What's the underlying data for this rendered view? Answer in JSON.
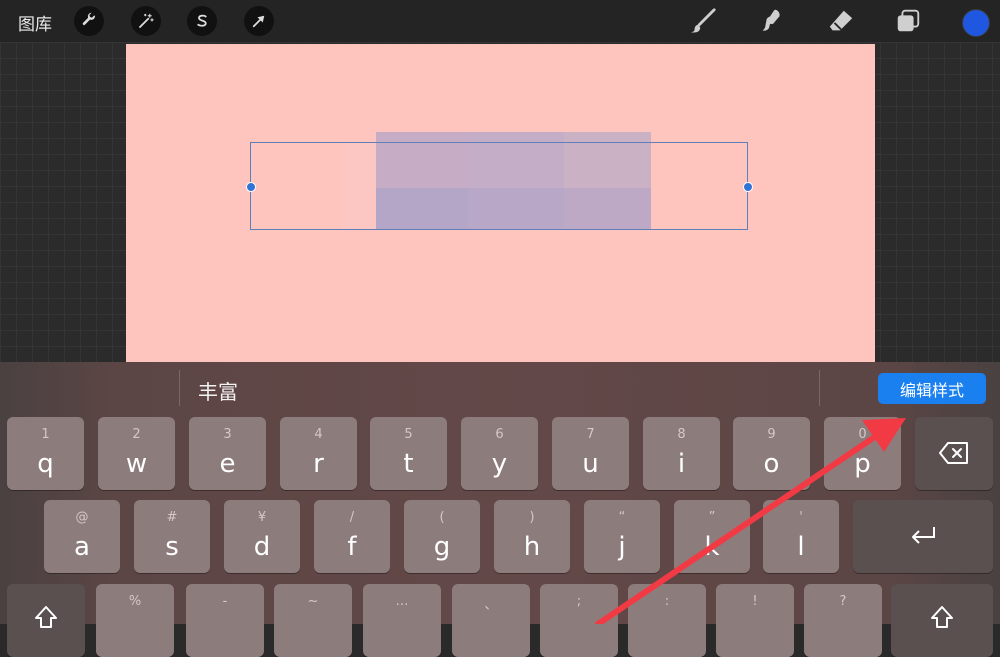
{
  "toolbar": {
    "gallery_label": "图库",
    "left_tools": [
      "wrench-icon",
      "magic-wand-icon",
      "selection-s-icon",
      "transform-arrow-icon"
    ],
    "right_tools": [
      "brush-icon",
      "smudge-icon",
      "eraser-icon",
      "layers-icon"
    ],
    "current_color": "#1f57e0"
  },
  "canvas": {
    "background_color": "#fec5bf",
    "text_box_colors": [
      "#c6adc5",
      "#c4adc7",
      "#cbb1c4",
      "#b4a6c7",
      "#b8a7c7",
      "#bda9c6"
    ]
  },
  "keyboard": {
    "candidate": "丰富",
    "edit_style_label": "编辑样式",
    "accent_color": "#1a80f0",
    "row1": [
      {
        "hint": "1",
        "key": "q"
      },
      {
        "hint": "2",
        "key": "w"
      },
      {
        "hint": "3",
        "key": "e"
      },
      {
        "hint": "4",
        "key": "r"
      },
      {
        "hint": "5",
        "key": "t"
      },
      {
        "hint": "6",
        "key": "y"
      },
      {
        "hint": "7",
        "key": "u"
      },
      {
        "hint": "8",
        "key": "i"
      },
      {
        "hint": "9",
        "key": "o"
      },
      {
        "hint": "0",
        "key": "p"
      }
    ],
    "row2": [
      {
        "hint": "@",
        "key": "a"
      },
      {
        "hint": "#",
        "key": "s"
      },
      {
        "hint": "¥",
        "key": "d"
      },
      {
        "hint": "/",
        "key": "f"
      },
      {
        "hint": "(",
        "key": "g"
      },
      {
        "hint": ")",
        "key": "h"
      },
      {
        "hint": "“",
        "key": "j"
      },
      {
        "hint": "”",
        "key": "k"
      },
      {
        "hint": "'",
        "key": "l"
      }
    ],
    "row3": [
      {
        "hint": "%",
        "key": ""
      },
      {
        "hint": "-",
        "key": ""
      },
      {
        "hint": "~",
        "key": ""
      },
      {
        "hint": "…",
        "key": ""
      },
      {
        "hint": "、",
        "key": ""
      },
      {
        "hint": ";",
        "key": ""
      },
      {
        "hint": ":",
        "key": ""
      },
      {
        "hint": "!",
        "key": ""
      },
      {
        "hint": "?",
        "key": ""
      }
    ],
    "special_keys": [
      "backspace-icon",
      "return-icon",
      "shift-icon"
    ]
  }
}
